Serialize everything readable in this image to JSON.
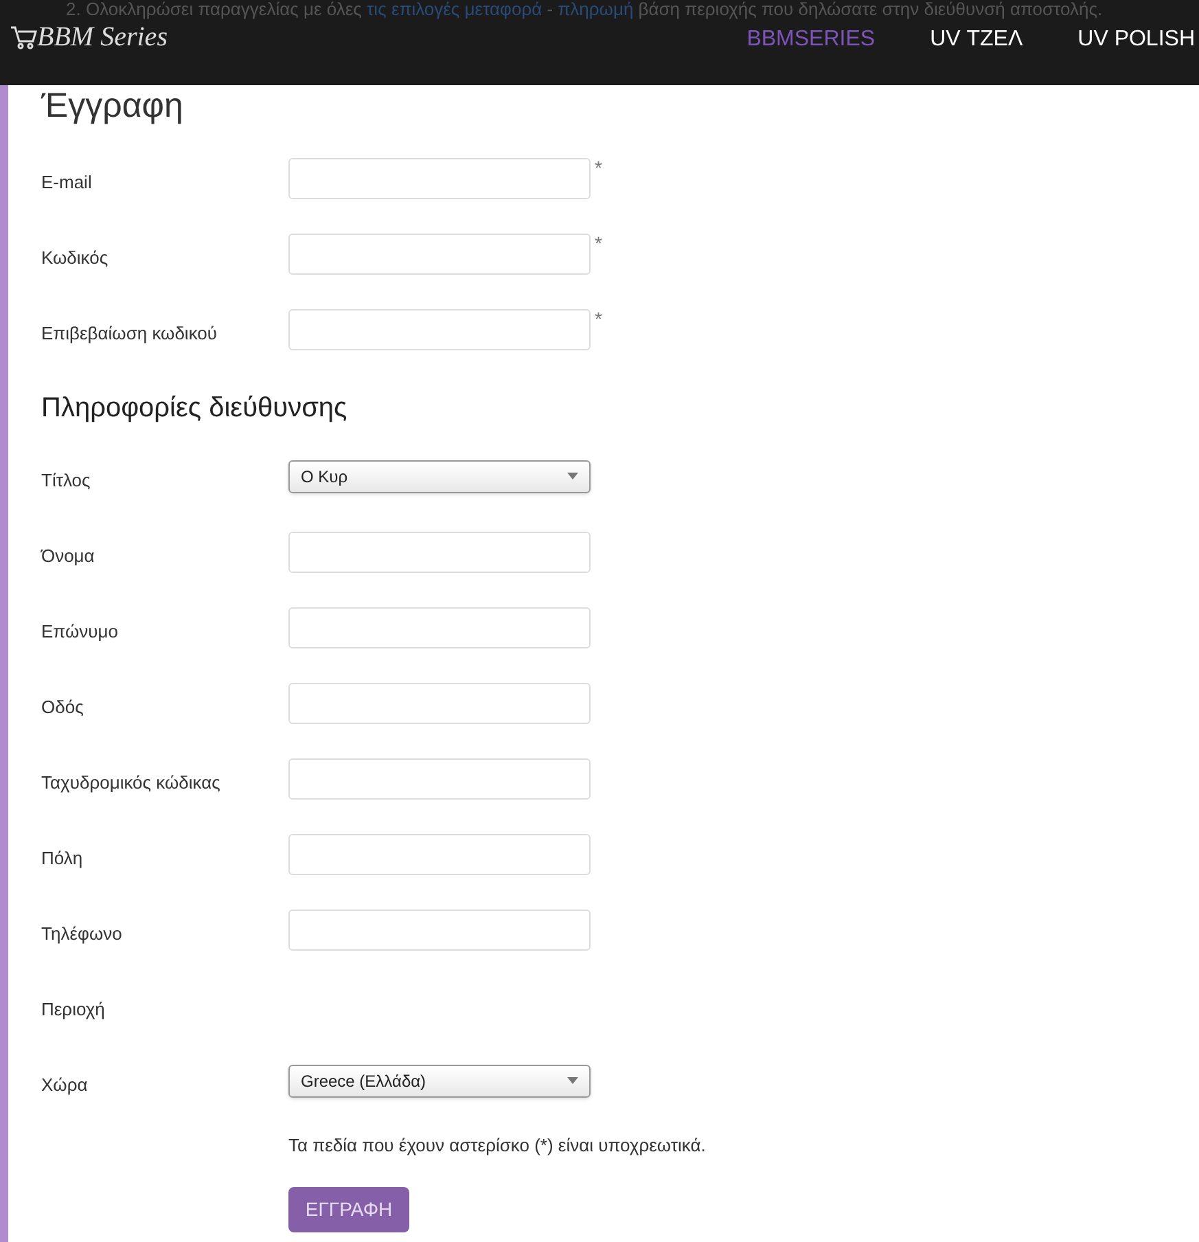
{
  "notice": "2. Ολοκληρώσει παραγγελίας με όλες **τις επιλογές μεταφορά** - **πληρωμή** βάση περιοχής που δηλώσατε στην διεύθυνσή αποστολής.",
  "header": {
    "logo": "BBM Series",
    "nav": [
      {
        "label": "BBMSERIES",
        "selected": true
      },
      {
        "label": "UV ΤΖΕΛ",
        "selected": false
      },
      {
        "label": "UV POLISH",
        "selected": false
      }
    ]
  },
  "required_marker": "*",
  "sections": [
    {
      "title": "Έγγραφη",
      "fields": [
        {
          "label": "E-mail",
          "kind": "text",
          "required": true
        },
        {
          "label": "Κωδικός",
          "kind": "text",
          "required": true
        },
        {
          "label": "Επιβεβαίωση κωδικού",
          "kind": "text",
          "required": true
        }
      ]
    },
    {
      "title": "Πληροφορίες διεύθυνσης",
      "fields": [
        {
          "label": "Τίτλος",
          "kind": "select",
          "value": "Ο Κυρ",
          "required": false
        },
        {
          "label": "Όνομα",
          "kind": "text",
          "required": false
        },
        {
          "label": "Επώνυμο",
          "kind": "text",
          "required": false
        },
        {
          "label": "Οδός",
          "kind": "text",
          "required": false
        },
        {
          "label": "Ταχυδρομικός κώδικας",
          "kind": "text",
          "required": false
        },
        {
          "label": "Πόλη",
          "kind": "text",
          "required": false
        },
        {
          "label": "Τηλέφωνο",
          "kind": "text",
          "required": false
        },
        {
          "label": "Περιοχή",
          "kind": "none",
          "required": false
        },
        {
          "label": "Χώρα",
          "kind": "select",
          "value": "Greece (Ελλάδα)",
          "required": false
        }
      ]
    }
  ],
  "required_note": "Τα πεδία που έχουν αστερίσκο (*) είναι υποχρεωτικά.",
  "submit": "ΕΓΓΡΑΦΗ"
}
